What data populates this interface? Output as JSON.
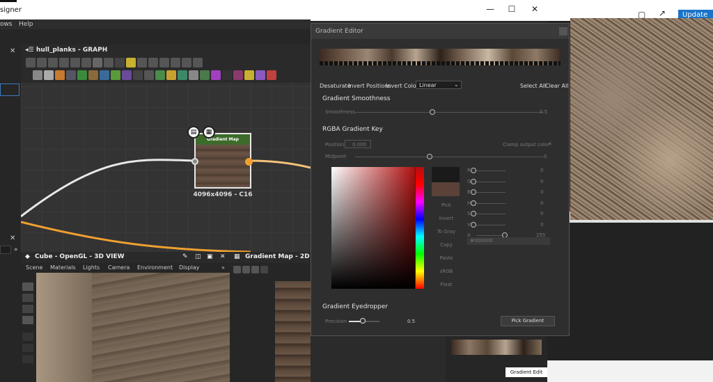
{
  "app": {
    "title_partial": "signer",
    "menu": [
      "ows",
      "Help"
    ]
  },
  "graph": {
    "title": "hull_planks - GRAPH",
    "node": {
      "header": "Gradient Map",
      "label": "4096x4096 - C16"
    }
  },
  "view3d": {
    "title": "Cube - OpenGL - 3D VIEW",
    "menu": [
      "Scene",
      "Materials",
      "Lights",
      "Camera",
      "Environment",
      "Display"
    ]
  },
  "view2d": {
    "title": "Gradient Map - 2D VIEW"
  },
  "editor": {
    "title": "Gradient Editor",
    "actions": {
      "desaturate": "Desaturate",
      "invert_positions": "Invert Positions",
      "invert_colors": "Invert Colors",
      "mode": "Linear",
      "select_all": "Select All",
      "clear_all": "Clear All"
    },
    "smoothness": {
      "section": "Gradient Smoothness",
      "label": "Smoothness",
      "value": "0.5"
    },
    "key": {
      "section": "RGBA Gradient Key",
      "position_label": "Position:",
      "position_value": "0.000",
      "clamp": "Clamp output color",
      "midpoint_label": "Midpoint",
      "midpoint_value": "0"
    },
    "side_buttons": [
      "Pick",
      "Invert",
      "To Gray",
      "Copy",
      "Paste",
      "sRGB",
      "Float"
    ],
    "channels": [
      {
        "name": "R",
        "value": "0"
      },
      {
        "name": "G",
        "value": "0"
      },
      {
        "name": "B",
        "value": "0"
      },
      {
        "name": "H",
        "value": "0"
      },
      {
        "name": "S",
        "value": "0"
      },
      {
        "name": "V",
        "value": "0"
      },
      {
        "name": "A",
        "value": "255"
      }
    ],
    "hex": "#000000",
    "eyedropper": {
      "section": "Gradient Eyedropper",
      "precision_label": "Precision",
      "precision_value": "0.5",
      "pick_button": "Pick Gradient"
    }
  },
  "right": {
    "update": "Update",
    "gradient_edit": "Gradient Edit"
  },
  "colors": {
    "accent_orange": "#f0a030",
    "node_green": "#3d6b2a"
  }
}
